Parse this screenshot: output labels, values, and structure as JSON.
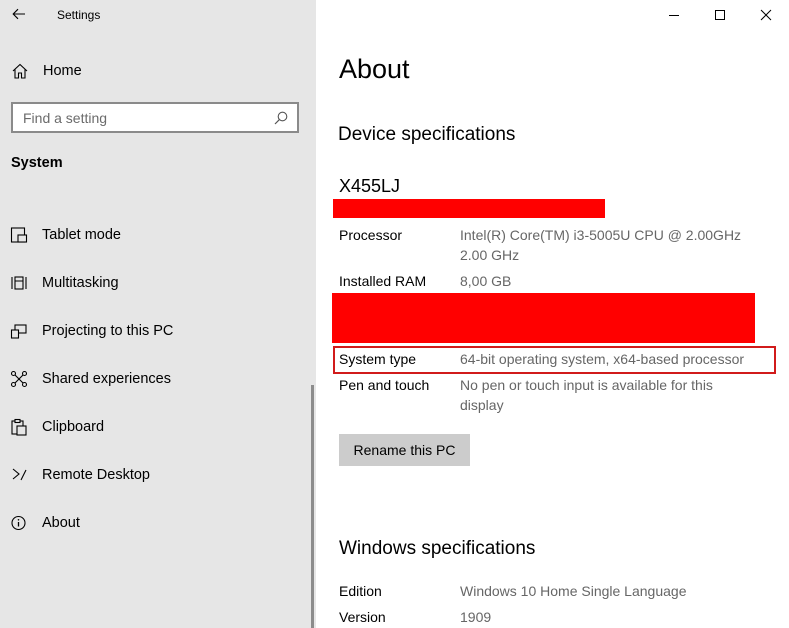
{
  "app": {
    "title": "Settings"
  },
  "sidebar": {
    "home_label": "Home",
    "search_placeholder": "Find a setting",
    "section": "System",
    "items": [
      {
        "label": "Tablet mode",
        "icon": "tablet-mode-icon"
      },
      {
        "label": "Multitasking",
        "icon": "multitasking-icon"
      },
      {
        "label": "Projecting to this PC",
        "icon": "projecting-icon"
      },
      {
        "label": "Shared experiences",
        "icon": "shared-experiences-icon"
      },
      {
        "label": "Clipboard",
        "icon": "clipboard-icon"
      },
      {
        "label": "Remote Desktop",
        "icon": "remote-desktop-icon"
      },
      {
        "label": "About",
        "icon": "info-icon"
      }
    ]
  },
  "main": {
    "title": "About",
    "device_heading": "Device specifications",
    "device_name": "X455LJ",
    "specs": {
      "processor_label": "Processor",
      "processor_value_line1": "Intel(R) Core(TM) i3-5005U CPU @ 2.00GHz",
      "processor_value_line2": "2.00 GHz",
      "ram_label": "Installed RAM",
      "ram_value": "8,00 GB",
      "system_type_label": "System type",
      "system_type_value": "64-bit operating system, x64-based processor",
      "pen_label": "Pen and touch",
      "pen_value_line1": "No pen or touch input is available for this",
      "pen_value_line2": "display"
    },
    "rename_button": "Rename this PC",
    "windows_heading": "Windows specifications",
    "windows_specs": {
      "edition_label": "Edition",
      "edition_value": "Windows 10 Home Single Language",
      "version_label": "Version",
      "version_value": "1909"
    }
  },
  "colors": {
    "sidebar_bg": "#e6e6e6",
    "redaction": "#ff0000",
    "highlight_border": "#d11b1b",
    "button_bg": "#cccccc"
  }
}
